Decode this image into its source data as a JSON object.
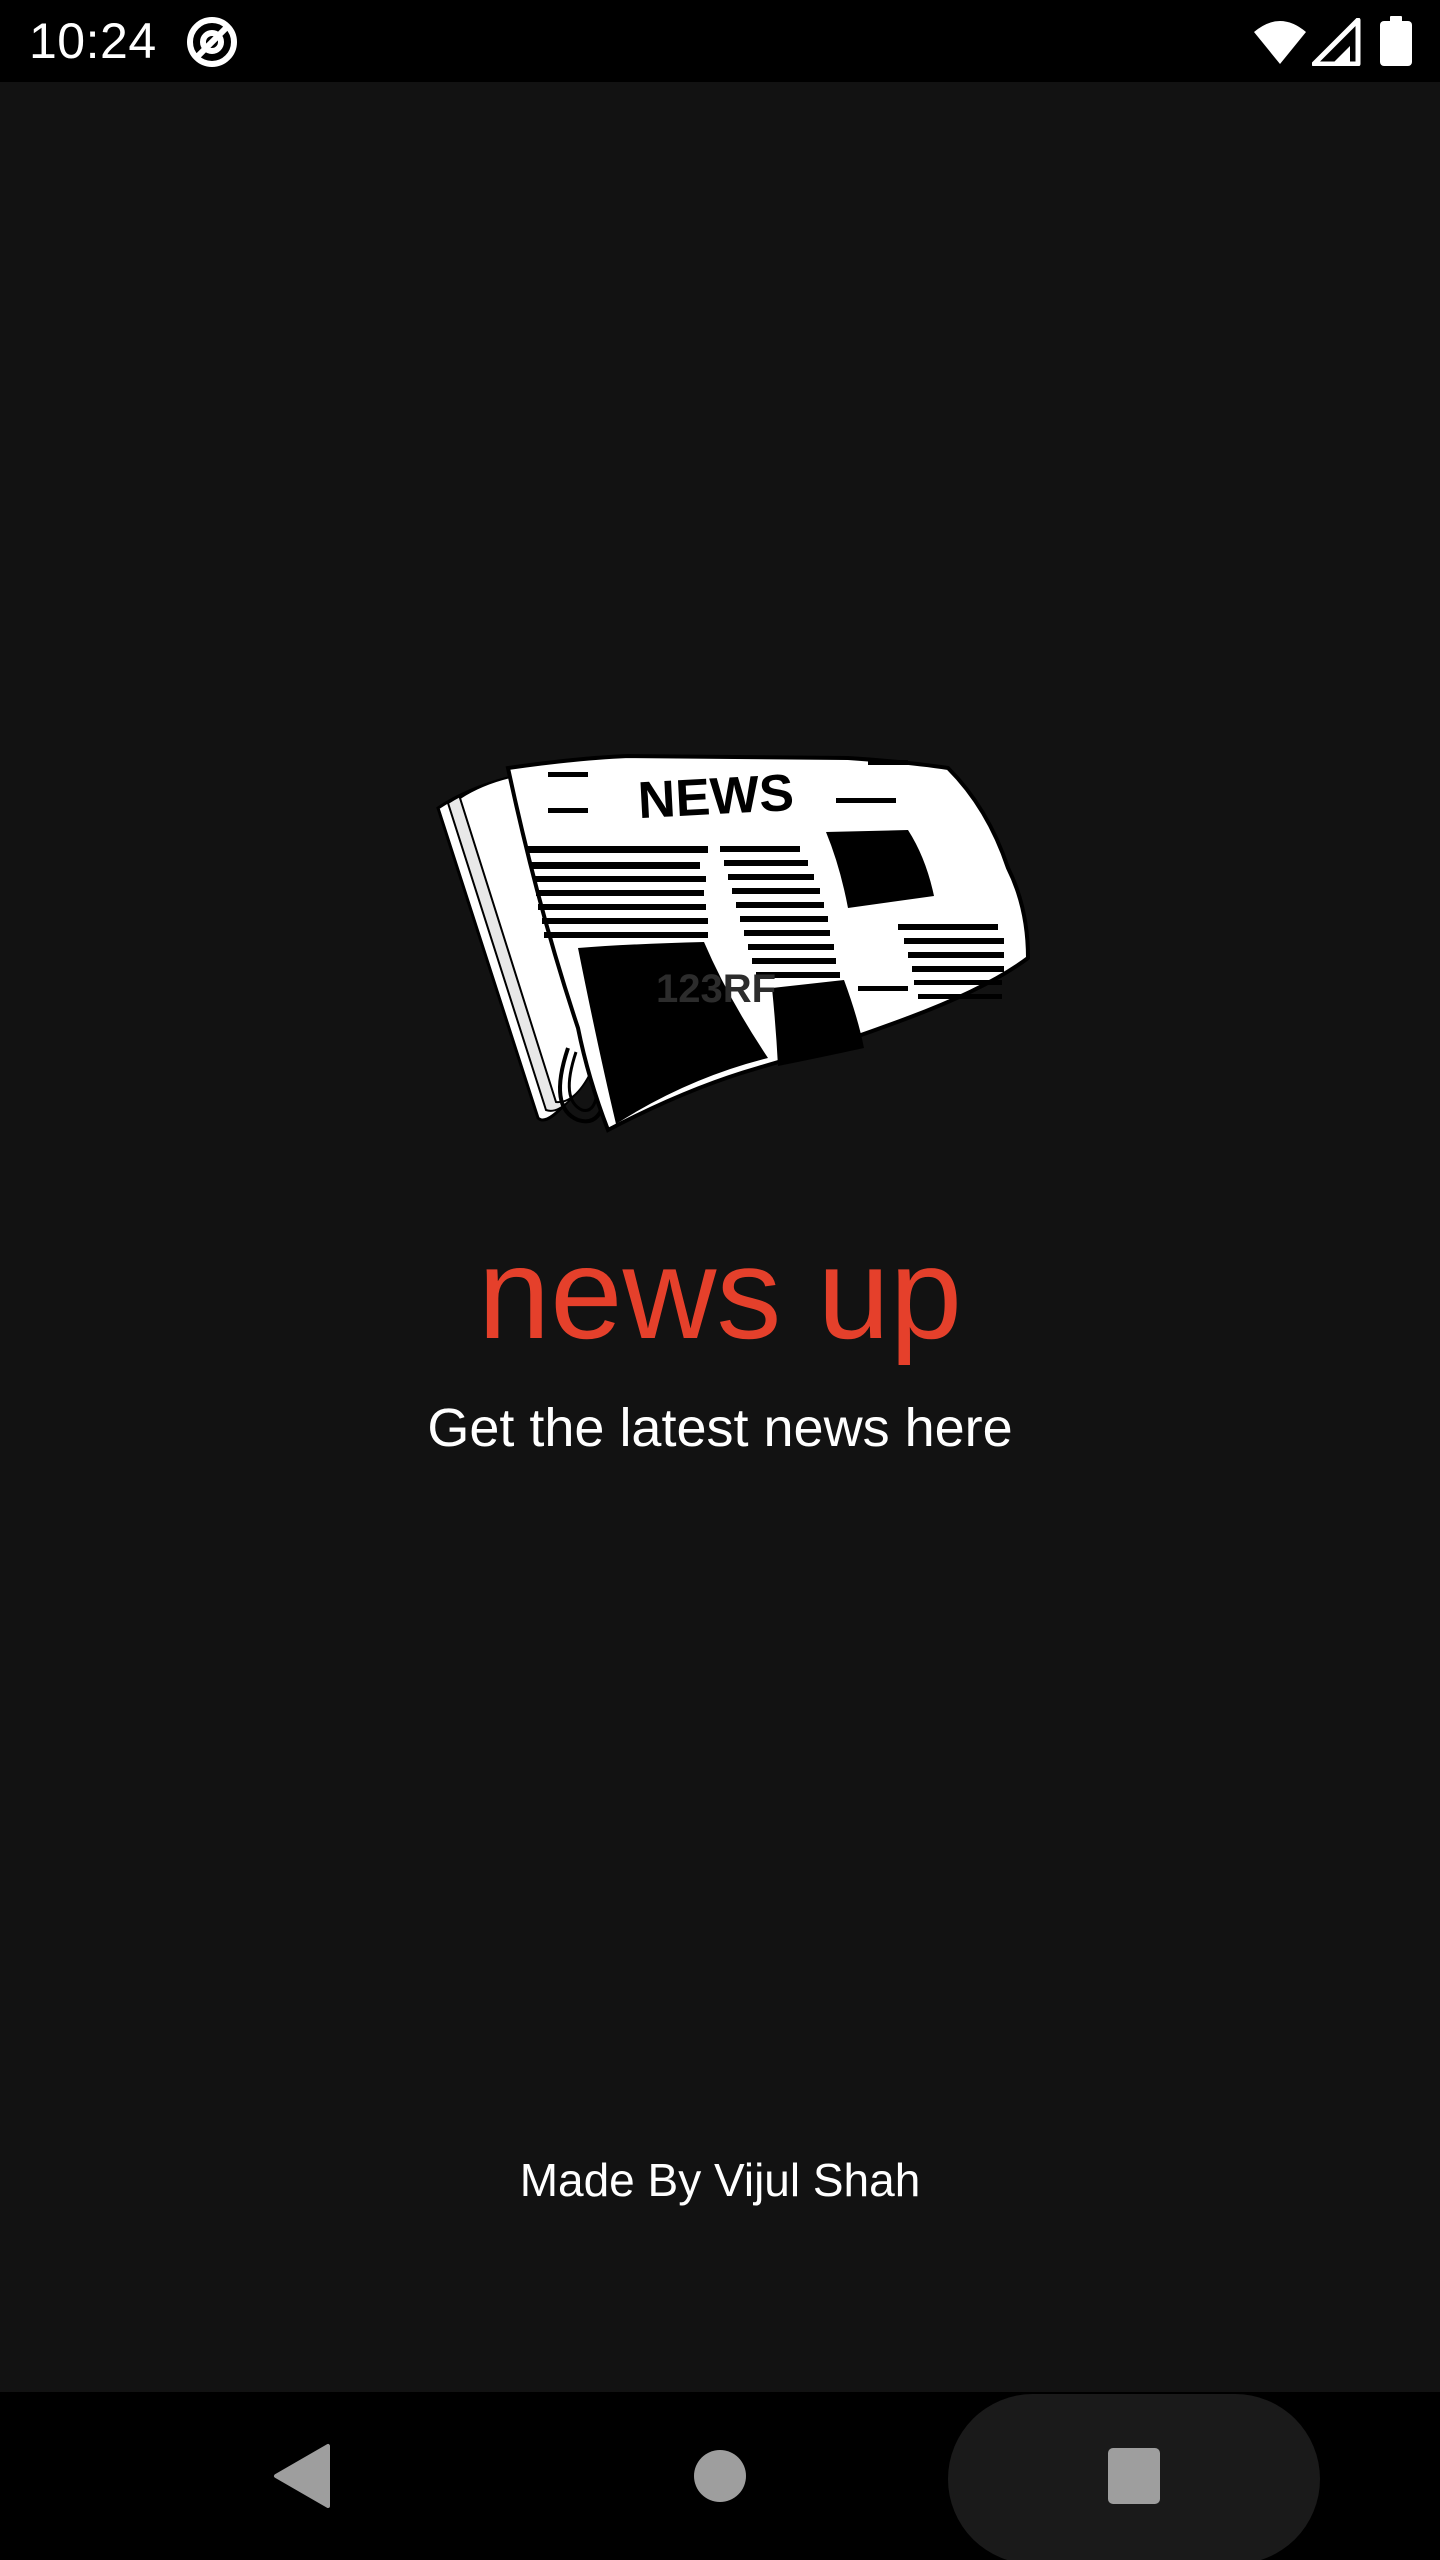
{
  "status_bar": {
    "time": "10:24",
    "icons": [
      "at-sign-icon",
      "wifi-icon",
      "cellular-signal-icon",
      "battery-icon"
    ]
  },
  "splash": {
    "logo": {
      "icon": "newspaper-icon",
      "headline_text": "NEWS",
      "watermark_text": "123RF"
    },
    "title": "news up",
    "subtitle": "Get the latest news here",
    "credit": "Made By Vijul Shah"
  },
  "nav_bar": {
    "icons": [
      "back-icon",
      "home-icon",
      "recents-icon"
    ]
  },
  "colors": {
    "background": "#121212",
    "accent": "#e5402b",
    "bars": "#000000",
    "nav_icon": "#9e9e9e"
  }
}
